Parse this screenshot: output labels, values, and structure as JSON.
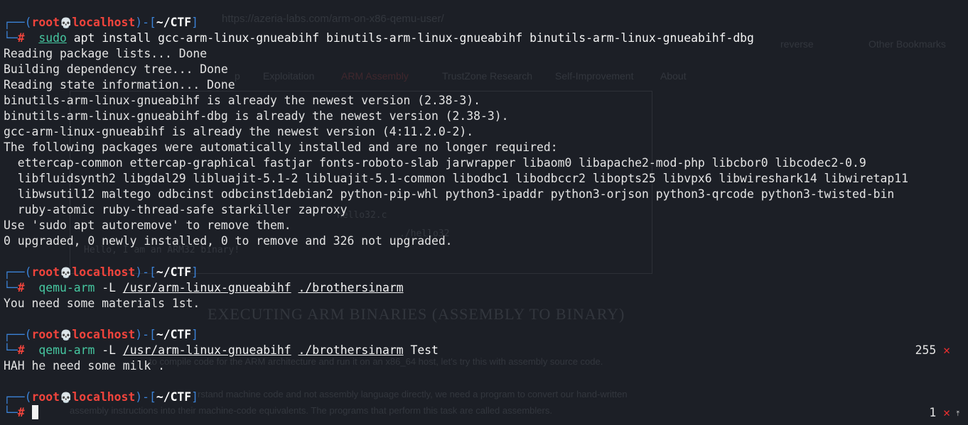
{
  "prompt": {
    "user": "root",
    "skull": "💀",
    "host": "localhost",
    "dir": "~/CTF",
    "symbol": "#"
  },
  "cmd1": {
    "sudo": "sudo",
    "rest": " apt install gcc-arm-linux-gnueabihf binutils-arm-linux-gnueabihf binutils-arm-linux-gnueabihf-dbg",
    "output": [
      "Reading package lists... Done",
      "Building dependency tree... Done",
      "Reading state information... Done",
      "binutils-arm-linux-gnueabihf is already the newest version (2.38-3).",
      "binutils-arm-linux-gnueabihf-dbg is already the newest version (2.38-3).",
      "gcc-arm-linux-gnueabihf is already the newest version (4:11.2.0-2).",
      "The following packages were automatically installed and are no longer required:",
      "  ettercap-common ettercap-graphical fastjar fonts-roboto-slab jarwrapper libaom0 libapache2-mod-php libcbor0 libcodec2-0.9",
      "  libfluidsynth2 libgdal29 libluajit-5.1-2 libluajit-5.1-common libodbc1 libodbccr2 libopts25 libvpx6 libwireshark14 libwiretap11",
      "  libwsutil12 maltego odbcinst odbcinst1debian2 python-pip-whl python3-ipaddr python3-orjson python3-qrcode python3-twisted-bin",
      "  ruby-atomic ruby-thread-safe starkiller zaproxy",
      "Use 'sudo apt autoremove' to remove them.",
      "0 upgraded, 0 newly installed, 0 to remove and 326 not upgraded."
    ]
  },
  "cmd2": {
    "prog": "qemu-arm",
    "flag": "-L",
    "path": "/usr/arm-linux-gnueabihf",
    "bin": "./brothersinarm",
    "output": "You need some materials 1st."
  },
  "cmd3": {
    "prog": "qemu-arm",
    "flag": "-L",
    "path": "/usr/arm-linux-gnueabihf",
    "bin": "./brothersinarm",
    "arg": " Test",
    "exit_code": "255",
    "output": "HAH he need some milk ."
  },
  "cmd4": {
    "exit_code": "1"
  },
  "status_icon": "✕",
  "scroll_glyph": "⤒",
  "background_page": {
    "url": "https://azeria-labs.com/arm-on-x86-qemu-user/",
    "bookmarks": [
      "reverse",
      "Other Bookmarks"
    ],
    "nav": [
      "p",
      "Exploitation",
      "ARM Assembly",
      "TrustZone Research",
      "Self-Improvement",
      "About"
    ],
    "code": [
      "hello32.c",
      "./hello32",
      "Hello, I am an ARM32 binary!"
    ],
    "heading": "EXECUTING ARM BINARIES (ASSEMBLY TO BINARY)",
    "para1": "to compile code for the ARM architecture and run it on an x86_64 host, let's try this with assembly source code.",
    "para2": "rstand machine code and not assembly language directly, we need a program to convert our hand-written",
    "para3": "assembly instructions into their machine-code equivalents. The programs that perform this task are called assemblers."
  },
  "colors": {
    "background": "#1c1f26",
    "prompt_frame": "#3b82d6",
    "prompt_user_host": "#f0443c",
    "command": "#46c7a0",
    "error_mark": "#ea2f2f"
  }
}
